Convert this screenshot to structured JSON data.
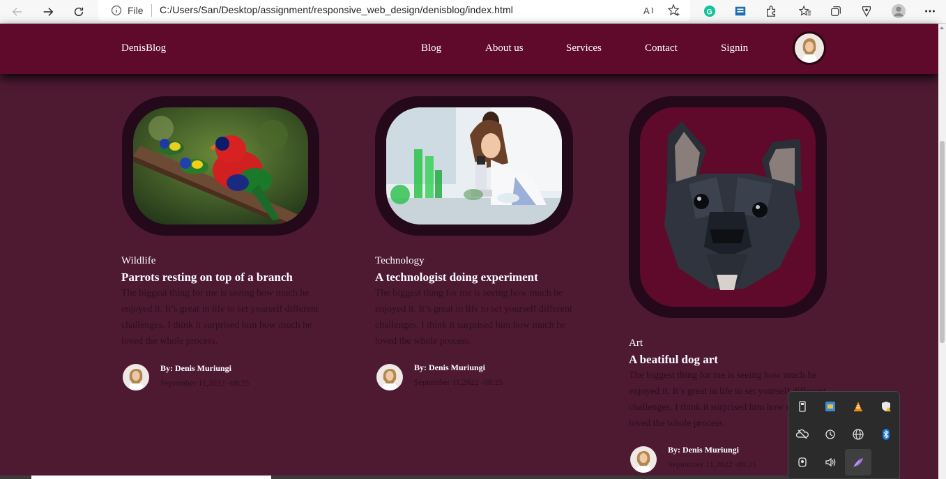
{
  "browser": {
    "file_label": "File",
    "url": "C:/Users/San/Desktop/assignment/responsive_web_design/denisblog/index.html"
  },
  "site": {
    "brand": "DenisBlog",
    "nav": [
      "Blog",
      "About us",
      "Services",
      "Contact",
      "Signin"
    ]
  },
  "posts": [
    {
      "category": "Wildlife",
      "title": "Parrots resting on top of a branch",
      "description": "The biggest thing for me is seeing how much he enjoyed it. It’s great in life to set yourself different challenges. I think it surprised him how much he loved the whole process.",
      "author": "By: Denis Muriungi",
      "date": "September 11,2022 -08:25",
      "image": "parrots-image"
    },
    {
      "category": "Technology",
      "title": "A technologist doing experiment",
      "description": "The biggest thing for me is seeing how much he enjoyed it. It’s great in life to set yourself different challenges. I think it surprised him how much he loved the whole process.",
      "author": "By: Denis Muriungi",
      "date": "September 11,2022 -08:25",
      "image": "lab-image"
    },
    {
      "category": "Art",
      "title": "A beatiful dog art",
      "description": "The biggest thing for me is seeing how much he enjoyed it. It’s great in life to set yourself different challenges. I think it surprised him how much he loved the whole process.",
      "author": "By: Denis Muriungi",
      "date": "September 11,2022 -08:25",
      "image": "dog-art-image"
    }
  ],
  "colors": {
    "header_bg": "#5f0a2a",
    "page_bg": "#4e1a32",
    "frame_bg": "#24091a",
    "muted_text": "#2c0d1e"
  }
}
